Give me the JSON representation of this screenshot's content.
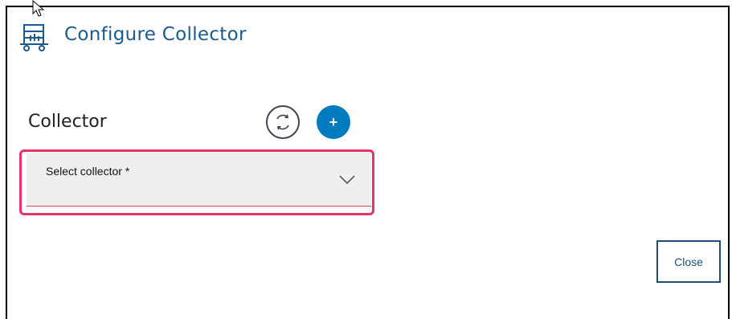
{
  "dialog": {
    "title": "Configure Collector"
  },
  "collector": {
    "label": "Collector",
    "select_label": "Select collector *",
    "refresh_icon": "refresh-icon",
    "add_icon": "plus-icon",
    "add_symbol": "+"
  },
  "actions": {
    "close_label": "Close"
  },
  "colors": {
    "title": "#1a5a8c",
    "accent": "#007bc0",
    "highlight": "#e8336a",
    "field_underline": "#e0414f",
    "close_border": "#1f4e79"
  }
}
